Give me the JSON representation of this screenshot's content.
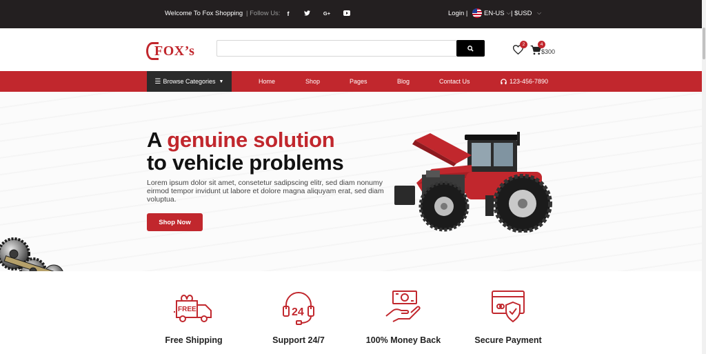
{
  "topbar": {
    "welcome": "Welcome To Fox Shopping",
    "follow": "| Follow Us:",
    "social_icons": [
      "facebook-icon",
      "twitter-icon",
      "google-plus-icon",
      "youtube-icon"
    ],
    "social_glyphs": [
      "f",
      "🐦",
      "G+",
      "▶"
    ],
    "login": "Login |",
    "language": "EN-US",
    "currency": "| $USD"
  },
  "header": {
    "logo_text": "FOX’s",
    "search_placeholder": "",
    "wishlist_count": "2",
    "cart_count": "4",
    "cart_total": "$300"
  },
  "nav": {
    "browse": "Browse Categories",
    "links": [
      "Home",
      "Shop",
      "Pages",
      "Blog",
      "Contact Us"
    ],
    "phone": "123-456-7890"
  },
  "hero": {
    "title_prefix": "A ",
    "title_highlight": "genuine solution",
    "title_line2": "to vehicle problems",
    "description": "Lorem ipsum dolor sit amet, consetetur sadipscing elitr, sed diam nonumy eirmod tempor invidunt ut labore et dolore magna aliquyam erat, sed diam voluptua.",
    "cta": "Shop Now"
  },
  "features": [
    {
      "label": "Free Shipping",
      "icon": "free-shipping-truck-icon",
      "badge": "FREE"
    },
    {
      "label": "Support 24/7",
      "icon": "support-headset-icon",
      "badge": "24"
    },
    {
      "label": "100% Money Back",
      "icon": "money-back-icon"
    },
    {
      "label": "Secure Payment",
      "icon": "secure-payment-icon"
    }
  ],
  "colors": {
    "accent": "#c1272d",
    "topbar": "#231f20",
    "browse_bg": "#2b2b2b"
  }
}
